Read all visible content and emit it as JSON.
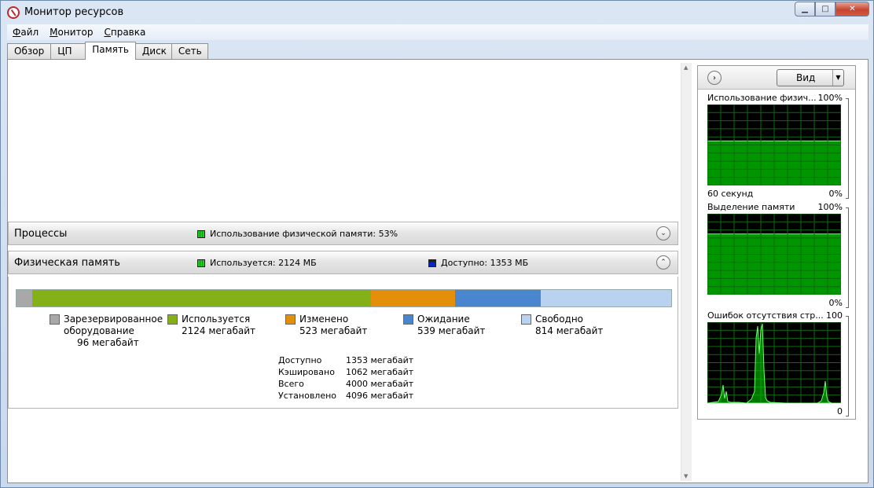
{
  "window": {
    "title": "Монитор ресурсов"
  },
  "menu": [
    {
      "label": "Файл",
      "accel": "Ф",
      "rest": "айл"
    },
    {
      "label": "Монитор",
      "accel": "М",
      "rest": "онитор"
    },
    {
      "label": "Справка",
      "accel": "С",
      "rest": "правка"
    }
  ],
  "tabs": [
    {
      "label": "Обзор",
      "active": false
    },
    {
      "label": "ЦП",
      "active": false
    },
    {
      "label": "Память",
      "active": true
    },
    {
      "label": "Диск",
      "active": false
    },
    {
      "label": "Сеть",
      "active": false
    }
  ],
  "processes": {
    "title": "Процессы",
    "legend": "Использование физической памяти: 53%"
  },
  "physical_memory": {
    "title": "Физическая память",
    "legend_used": "Используется: 2124 МБ",
    "legend_available": "Доступно: 1353 МБ",
    "bar": [
      {
        "name": "reserved",
        "mb": 96,
        "color": "#a8a8a8"
      },
      {
        "name": "in-use",
        "mb": 2124,
        "color": "#84b118"
      },
      {
        "name": "modified",
        "mb": 523,
        "color": "#e48f0a"
      },
      {
        "name": "standby",
        "mb": 539,
        "color": "#4a86d0"
      },
      {
        "name": "free",
        "mb": 814,
        "color": "#b8d2ef"
      }
    ],
    "legend": [
      {
        "line1": "Зарезервированное",
        "line2": "оборудование",
        "line3": "96 мегабайт",
        "color": "#a8a8a8"
      },
      {
        "line1": "Используется",
        "line2": "2124 мегабайт",
        "line3": "",
        "color": "#84b118"
      },
      {
        "line1": "Изменено",
        "line2": "523 мегабайт",
        "line3": "",
        "color": "#e48f0a"
      },
      {
        "line1": "Ожидание",
        "line2": "539 мегабайт",
        "line3": "",
        "color": "#4a86d0"
      },
      {
        "line1": "Свободно",
        "line2": "814 мегабайт",
        "line3": "",
        "color": "#b8d2ef"
      }
    ],
    "stats": [
      {
        "label": "Доступно",
        "value": "1353 мегабайт"
      },
      {
        "label": "Кэшировано",
        "value": "1062 мегабайт"
      },
      {
        "label": "Всего",
        "value": "4000 мегабайт"
      },
      {
        "label": "Установлено",
        "value": "4096 мегабайт"
      }
    ]
  },
  "side_panel": {
    "view_label": "Вид",
    "graphs": [
      {
        "title": "Использование физич...",
        "max": "100%",
        "foot_left": "60 секунд",
        "foot_right": "0%",
        "level": 0.55
      },
      {
        "title": "Выделение памяти",
        "max": "100%",
        "foot_left": "",
        "foot_right": "0%",
        "level": 0.75
      },
      {
        "title": "Ошибок отсутствия стр...",
        "max": "100",
        "foot_left": "",
        "foot_right": "0",
        "level": 0
      }
    ]
  },
  "colors": {
    "graph_green": "#00c800",
    "graph_bg": "#000000",
    "grid": "#0c6b0c"
  }
}
